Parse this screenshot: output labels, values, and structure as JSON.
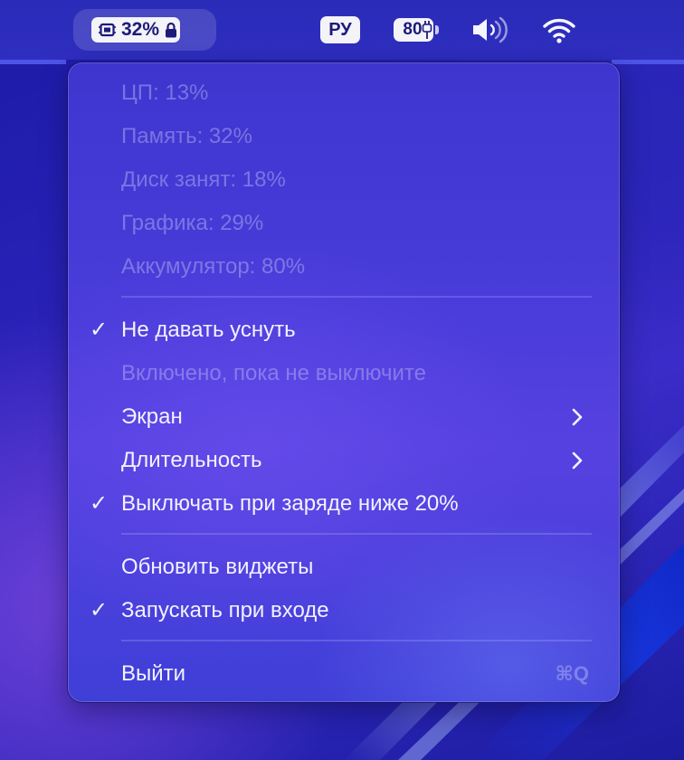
{
  "menubar": {
    "cpu_percent": "32%",
    "language": "РУ",
    "battery_level": "80",
    "icons": {
      "chip": "chip-icon",
      "lock": "lock-icon",
      "charging": "charging-plug-icon",
      "volume": "speaker-volume-icon",
      "wifi": "wifi-icon"
    }
  },
  "menu": {
    "stats": [
      "ЦП: 13%",
      "Память: 32%",
      "Диск занят: 18%",
      "Графика: 29%",
      "Аккумулятор: 80%"
    ],
    "keep_awake": {
      "label": "Не давать уснуть",
      "checked": true,
      "check_glyph": "✓",
      "status": "Включено, пока не выключите"
    },
    "screen": "Экран",
    "duration": "Длительность",
    "stop_low_battery": {
      "label": "Выключать при заряде ниже 20%",
      "checked": true,
      "check_glyph": "✓"
    },
    "refresh_widgets": "Обновить виджеты",
    "launch_at_login": {
      "label": "Запускать при входе",
      "checked": true,
      "check_glyph": "✓"
    },
    "quit": {
      "label": "Выйти",
      "shortcut": "⌘Q"
    }
  },
  "colors": {
    "menubar": "#2f2ec0",
    "menu_top": "#3e35cf",
    "menu_mid": "#5641e0",
    "text": "#f2f2ff",
    "disabled_text": "#8f88d8"
  }
}
